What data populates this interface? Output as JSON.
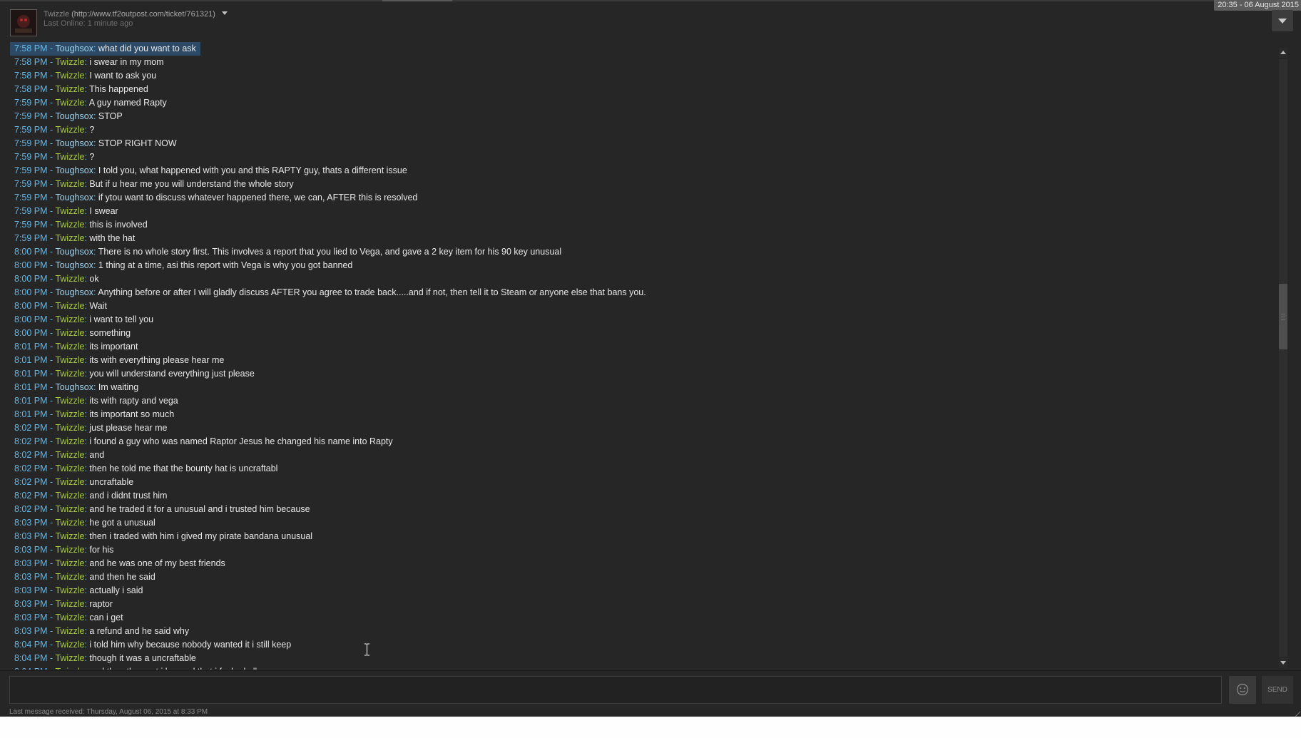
{
  "header": {
    "clock": "20:35 - 06 August 2015",
    "friend_name": "Twizzle",
    "friend_url": "(http://www.tf2outpost.com/ticket/761321)",
    "last_online": "Last Online: 1 minute ago"
  },
  "messages": [
    {
      "time": "7:58 PM",
      "from": "Toughsox",
      "text": "what did you want to ask",
      "selected": true
    },
    {
      "time": "7:58 PM",
      "from": "Twizzle",
      "text": "i swear in my mom"
    },
    {
      "time": "7:58 PM",
      "from": "Twizzle",
      "text": "I want to ask you"
    },
    {
      "time": "7:58 PM",
      "from": "Twizzle",
      "text": "This happened"
    },
    {
      "time": "7:59 PM",
      "from": "Twizzle",
      "text": "A guy named Rapty"
    },
    {
      "time": "7:59 PM",
      "from": "Toughsox",
      "text": "STOP"
    },
    {
      "time": "7:59 PM",
      "from": "Twizzle",
      "text": "?"
    },
    {
      "time": "7:59 PM",
      "from": "Toughsox",
      "text": "STOP RIGHT NOW"
    },
    {
      "time": "7:59 PM",
      "from": "Twizzle",
      "text": "?"
    },
    {
      "time": "7:59 PM",
      "from": "Toughsox",
      "text": "I told you, what happened with you and this RAPTY guy, thats a different issue"
    },
    {
      "time": "7:59 PM",
      "from": "Twizzle",
      "text": "But if u hear me you will understand the whole story"
    },
    {
      "time": "7:59 PM",
      "from": "Toughsox",
      "text": "if ytou want to discuss whatever happened there, we can, AFTER this is resolved"
    },
    {
      "time": "7:59 PM",
      "from": "Twizzle",
      "text": "I swear"
    },
    {
      "time": "7:59 PM",
      "from": "Twizzle",
      "text": "this is involved"
    },
    {
      "time": "7:59 PM",
      "from": "Twizzle",
      "text": "with the hat"
    },
    {
      "time": "8:00 PM",
      "from": "Toughsox",
      "text": "There is no whole story first. This involves a report that you lied to Vega, and gave a 2 key item for his 90 key unusual"
    },
    {
      "time": "8:00 PM",
      "from": "Toughsox",
      "text": "1 thing at a time, asi this report with Vega is why you got banned"
    },
    {
      "time": "8:00 PM",
      "from": "Twizzle",
      "text": "ok"
    },
    {
      "time": "8:00 PM",
      "from": "Toughsox",
      "text": "Anything before or after I will gladly discuss AFTER you agree to trade back.....and if not, then tell it to Steam or anyone else that bans you."
    },
    {
      "time": "8:00 PM",
      "from": "Twizzle",
      "text": "Wait"
    },
    {
      "time": "8:00 PM",
      "from": "Twizzle",
      "text": "i want to tell you"
    },
    {
      "time": "8:00 PM",
      "from": "Twizzle",
      "text": "something"
    },
    {
      "time": "8:01 PM",
      "from": "Twizzle",
      "text": "its important"
    },
    {
      "time": "8:01 PM",
      "from": "Twizzle",
      "text": "its with everything please hear me"
    },
    {
      "time": "8:01 PM",
      "from": "Twizzle",
      "text": "you will understand everything just please"
    },
    {
      "time": "8:01 PM",
      "from": "Toughsox",
      "text": "Im waiting"
    },
    {
      "time": "8:01 PM",
      "from": "Twizzle",
      "text": "its with rapty and vega"
    },
    {
      "time": "8:01 PM",
      "from": "Twizzle",
      "text": "its important so much"
    },
    {
      "time": "8:02 PM",
      "from": "Twizzle",
      "text": "just please hear me"
    },
    {
      "time": "8:02 PM",
      "from": "Twizzle",
      "text": "i found a guy who was named Raptor Jesus he changed his name into Rapty"
    },
    {
      "time": "8:02 PM",
      "from": "Twizzle",
      "text": "and"
    },
    {
      "time": "8:02 PM",
      "from": "Twizzle",
      "text": "then he told me that the bounty hat is uncraftabl"
    },
    {
      "time": "8:02 PM",
      "from": "Twizzle",
      "text": "uncraftable"
    },
    {
      "time": "8:02 PM",
      "from": "Twizzle",
      "text": "and i didnt trust him"
    },
    {
      "time": "8:02 PM",
      "from": "Twizzle",
      "text": "and he traded it for a unusual and i trusted him because"
    },
    {
      "time": "8:03 PM",
      "from": "Twizzle",
      "text": "he got a unusual"
    },
    {
      "time": "8:03 PM",
      "from": "Twizzle",
      "text": "then i traded with him i gived my pirate bandana unusual"
    },
    {
      "time": "8:03 PM",
      "from": "Twizzle",
      "text": "for his"
    },
    {
      "time": "8:03 PM",
      "from": "Twizzle",
      "text": "and he was one of my best friends"
    },
    {
      "time": "8:03 PM",
      "from": "Twizzle",
      "text": "and then he said"
    },
    {
      "time": "8:03 PM",
      "from": "Twizzle",
      "text": "actually i said"
    },
    {
      "time": "8:03 PM",
      "from": "Twizzle",
      "text": "raptor"
    },
    {
      "time": "8:03 PM",
      "from": "Twizzle",
      "text": "can i get"
    },
    {
      "time": "8:03 PM",
      "from": "Twizzle",
      "text": "a refund and he said why"
    },
    {
      "time": "8:04 PM",
      "from": "Twizzle",
      "text": "i told him why because nobody wanted it i still keep"
    },
    {
      "time": "8:04 PM",
      "from": "Twizzle",
      "text": "though it was a uncraftable"
    },
    {
      "time": "8:04 PM",
      "from": "Twizzle",
      "text": "and then the next i learned that i fucked all",
      "partial": true
    }
  ],
  "footer": {
    "send_label": "SEND",
    "status": "Last message received: Thursday, August 06, 2015 at 8:33 PM"
  },
  "colors": {
    "background": "#262626",
    "timestamp": "#62b8e8",
    "twizzle_name": "#a9cc3f",
    "toughsox_name": "#9ed3ef",
    "message_text": "#e8e8e8"
  }
}
